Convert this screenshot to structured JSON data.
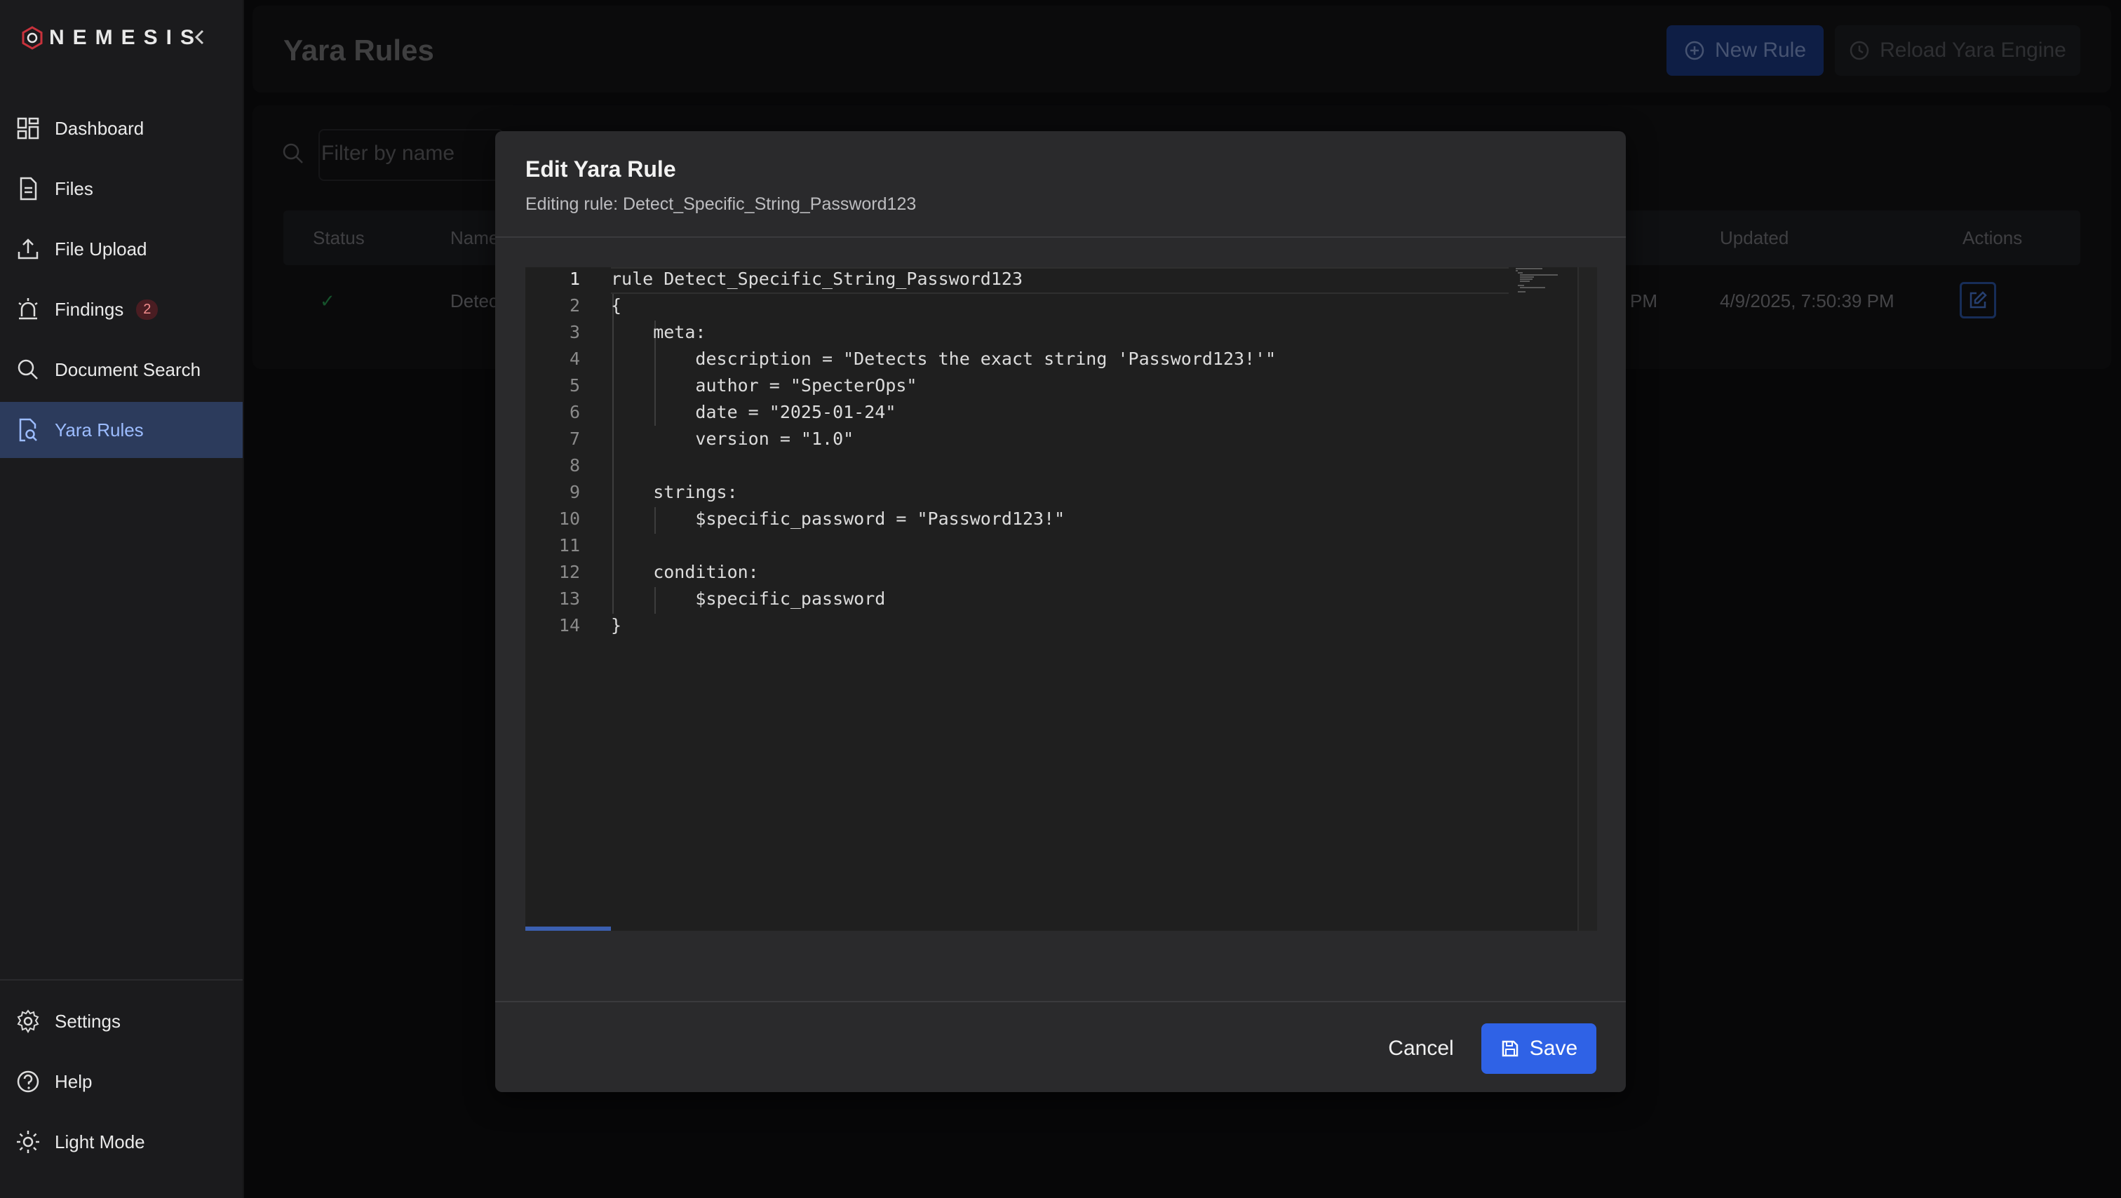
{
  "brand": {
    "name": "NEMESIS"
  },
  "sidebar": {
    "items": [
      {
        "label": "Dashboard",
        "icon": "dashboard-icon"
      },
      {
        "label": "Files",
        "icon": "file-icon"
      },
      {
        "label": "File Upload",
        "icon": "upload-icon"
      },
      {
        "label": "Findings",
        "icon": "alarm-icon",
        "badge": "2"
      },
      {
        "label": "Document Search",
        "icon": "search-icon"
      },
      {
        "label": "Yara Rules",
        "icon": "file-search-icon",
        "active": true
      }
    ],
    "bottom": [
      {
        "label": "Settings",
        "icon": "gear-icon"
      },
      {
        "label": "Help",
        "icon": "help-icon"
      },
      {
        "label": "Light Mode",
        "icon": "sun-icon"
      }
    ]
  },
  "page": {
    "title": "Yara Rules",
    "new_rule_label": "New Rule",
    "reload_label": "Reload Yara Engine",
    "filter_placeholder": "Filter by name"
  },
  "table": {
    "headers": {
      "status": "Status",
      "name": "Name",
      "updated": "Updated",
      "actions": "Actions"
    },
    "rows": [
      {
        "status": "✓",
        "name": "Detec",
        "created_partial": "PM",
        "updated": "4/9/2025, 7:50:39 PM"
      }
    ]
  },
  "modal": {
    "title": "Edit Yara Rule",
    "subtitle": "Editing rule: Detect_Specific_String_Password123",
    "cancel_label": "Cancel",
    "save_label": "Save",
    "code_lines": [
      "rule Detect_Specific_String_Password123",
      "{",
      "    meta:",
      "        description = \"Detects the exact string 'Password123!'\"",
      "        author = \"SpecterOps\"",
      "        date = \"2025-01-24\"",
      "        version = \"1.0\"",
      "",
      "    strings:",
      "        $specific_password = \"Password123!\"",
      "",
      "    condition:",
      "        $specific_password",
      "}"
    ],
    "line_numbers": [
      "1",
      "2",
      "3",
      "4",
      "5",
      "6",
      "7",
      "8",
      "9",
      "10",
      "11",
      "12",
      "13",
      "14"
    ]
  },
  "colors": {
    "accent": "#2f62e6",
    "active_nav_bg": "#2c3b5c",
    "status_ok": "#2aa556"
  }
}
